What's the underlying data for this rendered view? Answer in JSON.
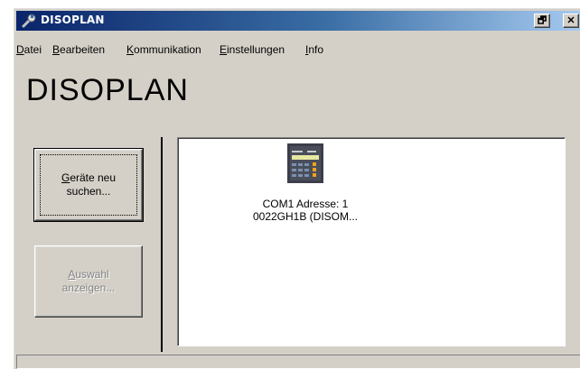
{
  "window": {
    "title": "DISOPLAN",
    "restore_symbol": "🗗",
    "close_symbol": "✕"
  },
  "menu": {
    "items": [
      {
        "acc": "D",
        "rest": "atei"
      },
      {
        "acc": "B",
        "rest": "earbeiten"
      },
      {
        "acc": "K",
        "rest": "ommunikation"
      },
      {
        "acc": "E",
        "rest": "instellungen"
      },
      {
        "acc": "I",
        "rest": "nfo"
      }
    ]
  },
  "heading": "DISOPLAN",
  "buttons": {
    "search": {
      "acc": "G",
      "rest": "eräte neu\nsuchen..."
    },
    "show": {
      "acc": "A",
      "rest": "uswahl\nanzeigen..."
    }
  },
  "device": {
    "label": "COM1 Adresse: 1\n0022GH1B (DISOM..."
  },
  "icons": {
    "app": "wrench-icon",
    "device": "device-terminal-icon"
  },
  "colors": {
    "titlebar_start": "#0a246a",
    "titlebar_end": "#a6caf0",
    "face": "#d4d0c8"
  }
}
